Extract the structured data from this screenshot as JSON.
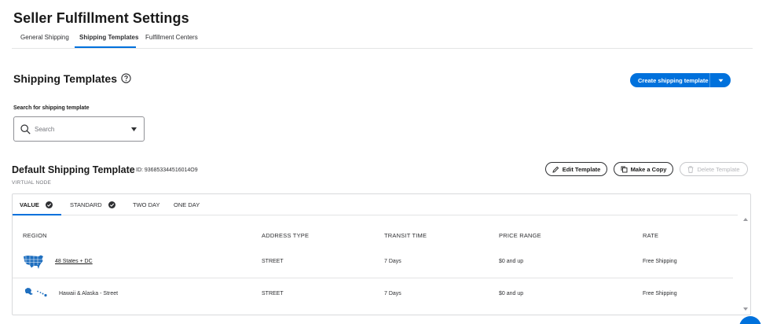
{
  "header": {
    "title": "Seller Fulfillment Settings"
  },
  "tabs": [
    {
      "label": "General Shipping"
    },
    {
      "label": "Shipping Templates"
    },
    {
      "label": "Fulfillment Centers"
    }
  ],
  "section": {
    "title": "Shipping Templates",
    "create_label": "Create shipping template"
  },
  "search": {
    "label": "Search for shipping template",
    "placeholder": "Search"
  },
  "template": {
    "title": "Default Shipping Template",
    "id": "ID: 936853344516014O9",
    "subtitle": "VIRTUAL NODE",
    "edit_label": "Edit Template",
    "copy_label": "Make a Copy",
    "delete_label": "Delete Template"
  },
  "speed_tabs": [
    {
      "label": "VALUE",
      "checked": true
    },
    {
      "label": "STANDARD",
      "checked": true
    },
    {
      "label": "TWO DAY",
      "checked": false
    },
    {
      "label": "ONE DAY",
      "checked": false
    }
  ],
  "table": {
    "headers": [
      "REGION",
      "ADDRESS TYPE",
      "TRANSIT TIME",
      "PRICE RANGE",
      "RATE"
    ],
    "rows": [
      {
        "region": "48 States + DC",
        "address_type": "STREET",
        "transit_time": "7 Days",
        "price_range": "$0 and up",
        "rate": "Free Shipping",
        "icon": "usa-map-icon"
      },
      {
        "region": "Hawaii & Alaska - Street",
        "address_type": "STREET",
        "transit_time": "7 Days",
        "price_range": "$0 and up",
        "rate": "Free Shipping",
        "icon": "hawaii-alaska-map-icon"
      }
    ]
  },
  "colors": {
    "accent": "#0071dc",
    "text": "#2e2f32",
    "border": "#d8d9dc"
  }
}
